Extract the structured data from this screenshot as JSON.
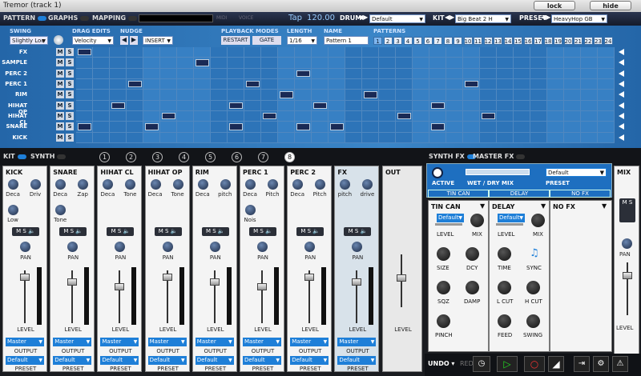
{
  "window": {
    "title": "Tremor (track 1)",
    "lock": "lock",
    "hide": "hide"
  },
  "tabs": {
    "pattern": "PATTERN",
    "graphs": "GRAPHS",
    "mapping": "MAPPING",
    "midi": "MIDI",
    "voice": "VOICE"
  },
  "transport": {
    "tap": "Tap",
    "bpm": "120.00"
  },
  "drum": {
    "label": "DRUM",
    "value": "Default"
  },
  "kit": {
    "label": "KIT",
    "value": "Big Beat 2  H"
  },
  "preset": {
    "label": "PRESET",
    "value": "HeavyHop GB"
  },
  "seq": {
    "swing_label": "SWING",
    "swing_value": "Slightly Loo",
    "drag_label": "DRAG EDITS",
    "drag_value": "Velocity",
    "nudge_label": "NUDGE",
    "nudge_mode": "INSERT",
    "playback_label": "PLAYBACK MODES",
    "restart": "RESTART",
    "gate": "GATE",
    "length_label": "LENGTH",
    "length_value": "1/16",
    "name_label": "NAME",
    "name_value": "Pattern 1",
    "patterns_label": "PATTERNS",
    "patterns": [
      "1",
      "2",
      "3",
      "4",
      "5",
      "6",
      "7",
      "8",
      "9",
      "10",
      "11",
      "12",
      "13",
      "14",
      "15",
      "16",
      "17",
      "18",
      "19",
      "20",
      "21",
      "22",
      "23",
      "24"
    ],
    "active_pattern": "1",
    "m": "M",
    "s": "S",
    "rows": [
      "FX",
      "SAMPLE",
      "PERC 2",
      "PERC 1",
      "RIM",
      "HIHAT OP",
      "HIHAT CL",
      "SNARE",
      "KICK"
    ]
  },
  "mixer": {
    "kit": "KIT",
    "synth": "SYNTH",
    "slots": [
      "1",
      "2",
      "3",
      "4",
      "5",
      "6",
      "7",
      "8"
    ],
    "pan": "PAN",
    "level": "LEVEL",
    "output": "OUTPUT",
    "preset": "PRESET",
    "output_value": "Master",
    "preset_value": "Default",
    "channels": [
      {
        "name": "KICK",
        "knobs": [
          "Deca",
          "Driv",
          "Low"
        ]
      },
      {
        "name": "SNARE",
        "knobs": [
          "Deca",
          "Zap",
          "Tone"
        ]
      },
      {
        "name": "HIHAT CL",
        "knobs": [
          "Deca",
          "Tone"
        ]
      },
      {
        "name": "HIHAT OP",
        "knobs": [
          "Deca",
          "Tone"
        ]
      },
      {
        "name": "RIM",
        "knobs": [
          "Deca",
          "pitch"
        ]
      },
      {
        "name": "PERC 1",
        "knobs": [
          "Deca",
          "Pitch",
          "Nois"
        ]
      },
      {
        "name": "PERC 2",
        "knobs": [
          "Deca",
          "Pitch"
        ]
      },
      {
        "name": "FX",
        "knobs": [
          "pitch",
          "drive"
        ]
      }
    ],
    "out": "OUT",
    "mix": "MIX"
  },
  "synthfx": {
    "synth_fx": "SYNTH FX",
    "master_fx": "MASTER FX",
    "active": "ACTIVE",
    "wetdry": "WET / DRY MIX",
    "preset": "PRESET",
    "preset_value": "Default",
    "tabs": [
      "TIN CAN",
      "DELAY",
      "NO FX"
    ],
    "tincan": {
      "name": "TIN CAN",
      "dd": "Default",
      "level": "LEVEL",
      "mix": "MIX",
      "knobs": [
        "SIZE",
        "DCY",
        "SQZ",
        "DAMP",
        "PINCH"
      ]
    },
    "delay": {
      "name": "DELAY",
      "dd": "Default",
      "level": "LEVEL",
      "mix": "MIX",
      "knobs": [
        "TIME",
        "SYNC",
        "L CUT",
        "H CUT",
        "FEED",
        "SWING"
      ]
    },
    "nofx": "NO FX",
    "undo": "UNDO",
    "redo": "REDO"
  },
  "colors": {
    "accent": "#1e7fd8",
    "grid": "#2d74b8"
  }
}
